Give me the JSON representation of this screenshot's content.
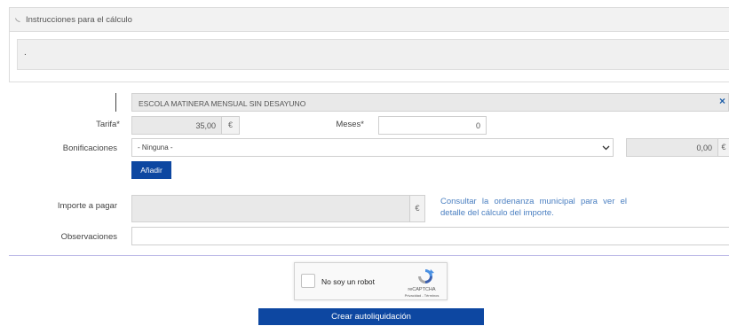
{
  "instructions": {
    "title": "Instrucciones para el cálculo",
    "body": "."
  },
  "concept": {
    "value": "ESCOLA MATINERA MENSUAL SIN DESAYUNO",
    "remove_icon": "×"
  },
  "tarifa": {
    "label": "Tarifa*",
    "value": "35,00",
    "currency": "€"
  },
  "meses": {
    "label": "Meses*",
    "value": "0"
  },
  "bonificaciones": {
    "label": "Bonificaciones",
    "selected": "- Ninguna -",
    "amount": "0,00",
    "currency": "€",
    "add_label": "Añadir"
  },
  "importe": {
    "label": "Importe a pagar",
    "value": "",
    "currency": "€",
    "info": "Consultar la ordenanza municipal para ver el detalle del cálculo del importe."
  },
  "observaciones": {
    "label": "Observaciones",
    "value": ""
  },
  "captcha": {
    "label": "No soy un robot",
    "brand": "reCAPTCHA",
    "links": "Privacidad - Términos"
  },
  "submit_label": "Crear autoliquidación",
  "colors": {
    "primary": "#0d47a1",
    "link": "#4a7fc1"
  }
}
